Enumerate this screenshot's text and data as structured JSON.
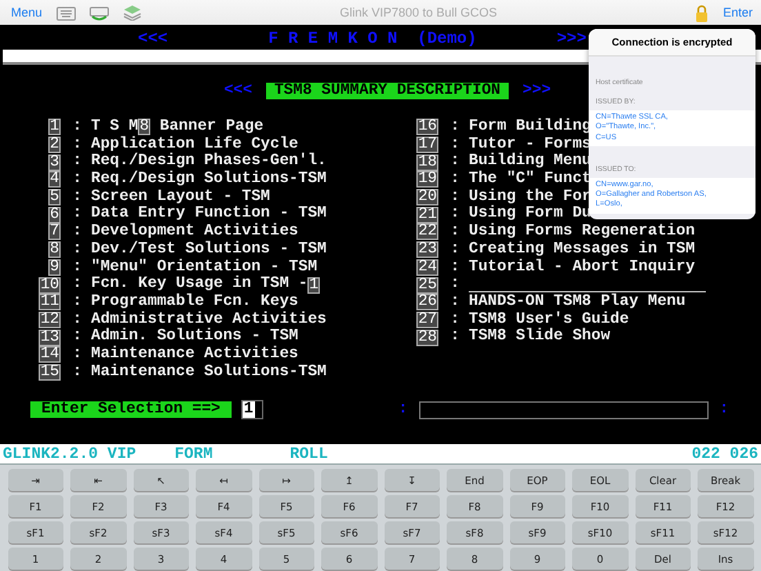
{
  "top_bar": {
    "menu_label": "Menu",
    "title": "Glink VIP7800 to Bull GCOS",
    "enter_label": "Enter"
  },
  "terminal": {
    "banner": {
      "left": "<<<",
      "title": "F R E M K O N  (Demo)",
      "right": ">>>"
    },
    "heading": {
      "left": "<<<",
      "title": "TSM8 SUMMARY DESCRIPTION",
      "right": ">>>"
    },
    "menu_columns": [
      [
        {
          "number": "1",
          "separator": ":",
          "parts": [
            {
              "kind": "text",
              "text": "T S M"
            },
            {
              "kind": "key",
              "text": "8"
            },
            {
              "kind": "text",
              "text": " Banner Page"
            }
          ]
        },
        {
          "number": "2",
          "separator": ":",
          "parts": [
            {
              "kind": "text",
              "text": "Application Life Cycle"
            }
          ]
        },
        {
          "number": "3",
          "separator": ":",
          "parts": [
            {
              "kind": "text",
              "text": "Req./Design Phases-Gen'l."
            }
          ]
        },
        {
          "number": "4",
          "separator": ":",
          "parts": [
            {
              "kind": "text",
              "text": "Req./Design Solutions-TSM"
            }
          ]
        },
        {
          "number": "5",
          "separator": ":",
          "parts": [
            {
              "kind": "text",
              "text": "Screen Layout - TSM"
            }
          ]
        },
        {
          "number": "6",
          "separator": ":",
          "parts": [
            {
              "kind": "text",
              "text": "Data Entry Function - TSM"
            }
          ]
        },
        {
          "number": "7",
          "separator": ":",
          "parts": [
            {
              "kind": "text",
              "text": "Development Activities"
            }
          ]
        },
        {
          "number": "8",
          "separator": ":",
          "parts": [
            {
              "kind": "text",
              "text": "Dev./Test Solutions - TSM"
            }
          ]
        },
        {
          "number": "9",
          "separator": ":",
          "parts": [
            {
              "kind": "text",
              "text": "\"Menu\" Orientation - TSM"
            }
          ]
        },
        {
          "number": "10",
          "separator": ":",
          "parts": [
            {
              "kind": "text",
              "text": "Fcn. Key Usage in TSM -"
            },
            {
              "kind": "key",
              "text": "1"
            }
          ]
        },
        {
          "number": "11",
          "separator": ":",
          "parts": [
            {
              "kind": "text",
              "text": "Programmable Fcn. Keys"
            }
          ]
        },
        {
          "number": "12",
          "separator": ":",
          "parts": [
            {
              "kind": "text",
              "text": "Administrative Activities"
            }
          ]
        },
        {
          "number": "13",
          "separator": ":",
          "parts": [
            {
              "kind": "text",
              "text": "Admin. Solutions - TSM"
            }
          ]
        },
        {
          "number": "14",
          "separator": ":",
          "parts": [
            {
              "kind": "text",
              "text": "Maintenance Activities"
            }
          ]
        },
        {
          "number": "15",
          "separator": ":",
          "parts": [
            {
              "kind": "text",
              "text": "Maintenance Solutions-TSM"
            }
          ]
        }
      ],
      [
        {
          "number": "16",
          "separator": ":",
          "parts": [
            {
              "kind": "text",
              "text": "Form Building"
            }
          ]
        },
        {
          "number": "17",
          "separator": ":",
          "parts": [
            {
              "kind": "text",
              "text": "Tutor - Forms"
            }
          ]
        },
        {
          "number": "18",
          "separator": ":",
          "parts": [
            {
              "kind": "text",
              "text": "Building Menu"
            }
          ]
        },
        {
          "number": "19",
          "separator": ":",
          "parts": [
            {
              "kind": "text",
              "text": "The \"C\" Funct"
            }
          ]
        },
        {
          "number": "20",
          "separator": ":",
          "parts": [
            {
              "kind": "text",
              "text": "Using the For"
            }
          ]
        },
        {
          "number": "21",
          "separator": ":",
          "parts": [
            {
              "kind": "text",
              "text": "Using Form Du"
            }
          ]
        },
        {
          "number": "22",
          "separator": ":",
          "parts": [
            {
              "kind": "text",
              "text": "Using Forms Regeneration"
            }
          ]
        },
        {
          "number": "23",
          "separator": ":",
          "parts": [
            {
              "kind": "text",
              "text": "Creating Messages in TSM"
            }
          ]
        },
        {
          "number": "24",
          "separator": ":",
          "parts": [
            {
              "kind": "text",
              "text": "Tutorial - Abort Inquiry"
            }
          ]
        },
        {
          "number": "25",
          "separator": ":",
          "parts": [
            {
              "kind": "rule"
            }
          ]
        },
        {
          "number": "26",
          "separator": ":",
          "parts": [
            {
              "kind": "text",
              "text": "HANDS-ON TSM8 Play Menu"
            }
          ]
        },
        {
          "number": "27",
          "separator": ":",
          "parts": [
            {
              "kind": "text",
              "text": "TSM8 User's Guide"
            }
          ]
        },
        {
          "number": "28",
          "separator": ":",
          "parts": [
            {
              "kind": "text",
              "text": "TSM8 Slide Show"
            }
          ]
        }
      ]
    ],
    "prompt": {
      "label": "Enter Selection ==>",
      "value": "1"
    },
    "second_field": {
      "left": ":",
      "right": ":"
    }
  },
  "status_line": {
    "app": "GLINK2.2.0 VIP",
    "mode": "FORM",
    "scroll": "ROLL",
    "cursor": "022 026"
  },
  "keypad": [
    [
      "⇥",
      "⇤",
      "↖",
      "↤",
      "↦",
      "↥",
      "↧",
      "End",
      "EOP",
      "EOL",
      "Clear",
      "Break"
    ],
    [
      "F1",
      "F2",
      "F3",
      "F4",
      "F5",
      "F6",
      "F7",
      "F8",
      "F9",
      "F10",
      "F11",
      "F12"
    ],
    [
      "sF1",
      "sF2",
      "sF3",
      "sF4",
      "sF5",
      "sF6",
      "sF7",
      "sF8",
      "sF9",
      "sF10",
      "sF11",
      "sF12"
    ],
    [
      "1",
      "2",
      "3",
      "4",
      "5",
      "6",
      "7",
      "8",
      "9",
      "0",
      "Del",
      "Ins"
    ]
  ],
  "popover": {
    "title": "Connection is encrypted",
    "subtitle": "Host certificate",
    "sections": [
      {
        "heading": "ISSUED BY:",
        "lines": [
          "CN=Thawte SSL CA,",
          "O=\"Thawte, Inc.\",",
          "C=US"
        ]
      },
      {
        "heading": "ISSUED TO:",
        "lines": [
          "CN=www.gar.no,",
          "O=Gallagher and Robertson AS,",
          "L=Oslo,"
        ]
      }
    ]
  }
}
